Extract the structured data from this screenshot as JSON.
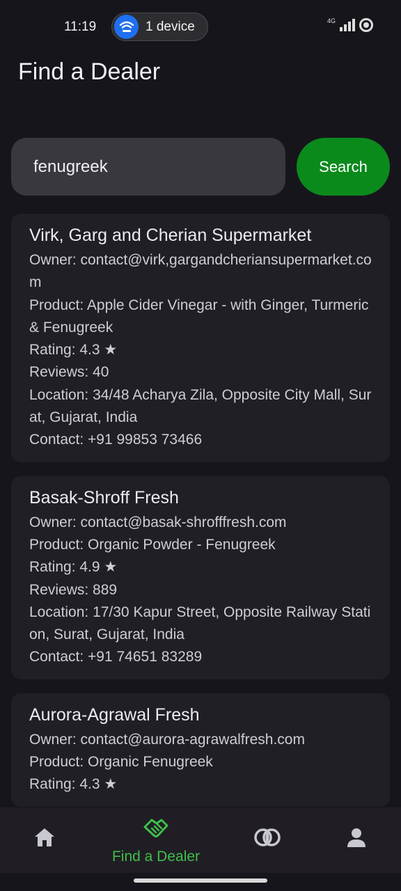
{
  "status_bar": {
    "time": "11:19",
    "device_pill": "1 device",
    "network": "4G"
  },
  "header": {
    "title": "Find a Dealer"
  },
  "search": {
    "value": "fenugreek",
    "button_label": "Search"
  },
  "dealers": [
    {
      "name": "Virk, Garg and Cherian Supermarket",
      "owner": "Owner: contact@virk,gargandcheriansupermarket.com",
      "product": "Product: Apple Cider Vinegar - with Ginger, Turmeric & Fenugreek",
      "rating": "Rating: 4.3 ★",
      "reviews": "Reviews: 40",
      "location": "Location: 34/48 Acharya Zila, Opposite City Mall, Surat, Gujarat, India",
      "contact": "Contact: +91 99853 73466"
    },
    {
      "name": "Basak-Shroff Fresh",
      "owner": "Owner: contact@basak-shrofffresh.com",
      "product": "Product: Organic Powder - Fenugreek",
      "rating": "Rating: 4.9 ★",
      "reviews": "Reviews: 889",
      "location": "Location: 17/30 Kapur Street, Opposite Railway Station, Surat, Gujarat, India",
      "contact": "Contact: +91 74651 83289"
    },
    {
      "name": "Aurora-Agrawal Fresh",
      "owner": "Owner: contact@aurora-agrawalfresh.com",
      "product": "Product: Organic Fenugreek",
      "rating": "Rating: 4.3 ★",
      "reviews": "",
      "location": "",
      "contact": ""
    }
  ],
  "bottom_nav": {
    "items": [
      {
        "icon": "home-icon",
        "label": ""
      },
      {
        "icon": "handshake-icon",
        "label": "Find a Dealer"
      },
      {
        "icon": "rings-icon",
        "label": ""
      },
      {
        "icon": "person-icon",
        "label": ""
      }
    ],
    "active_index": 1
  },
  "colors": {
    "background": "#17151c",
    "card": "#211f26",
    "accent_green": "#3fbf4a",
    "search_button": "#0b8a1c",
    "pill_blue": "#1f6ff0"
  }
}
